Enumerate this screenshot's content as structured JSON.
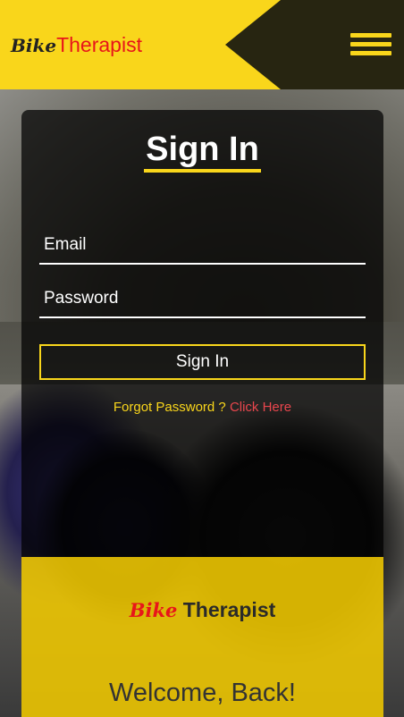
{
  "header": {
    "logo_bike": "Bike",
    "logo_therapist": "Therapist",
    "menu_icon": "hamburger-menu-icon"
  },
  "signin": {
    "title": "Sign In",
    "email_placeholder": "Email",
    "password_placeholder": "Password",
    "button_label": "Sign In",
    "forgot_text": "Forgot Password ?",
    "forgot_link": "Click Here"
  },
  "panel": {
    "logo_bike": "Bike",
    "logo_therapist": "Therapist",
    "welcome": "Welcome, Back!"
  },
  "colors": {
    "brand_yellow": "#f9d61b",
    "brand_red": "#e8151a",
    "header_dark": "#272511"
  }
}
